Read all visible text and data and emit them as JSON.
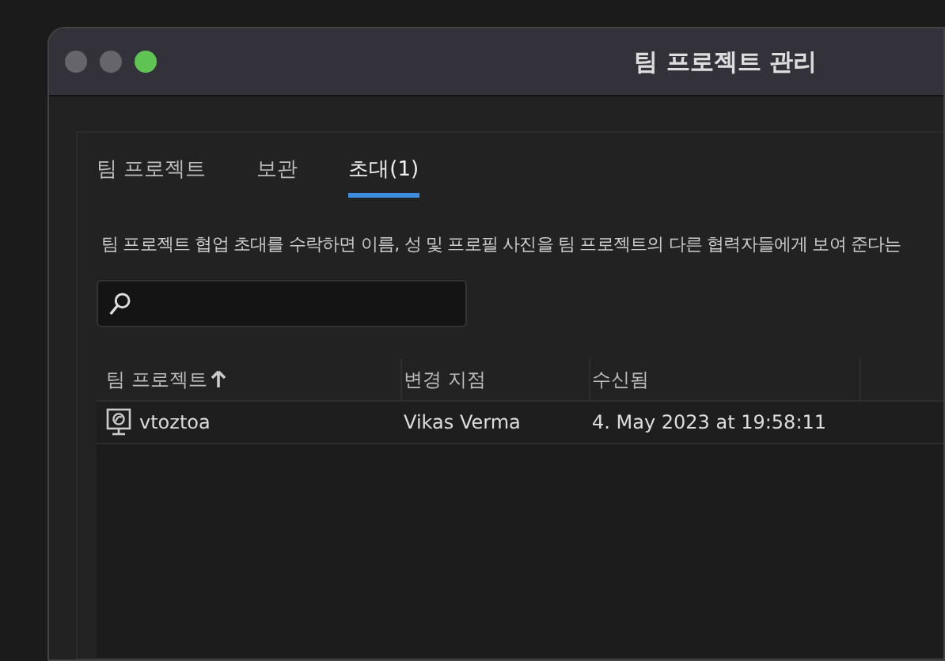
{
  "window": {
    "title": "팀 프로젝트 관리"
  },
  "traffic_lights": [
    {
      "kind": "close"
    },
    {
      "kind": "minimize"
    },
    {
      "kind": "zoom"
    }
  ],
  "tabs": [
    {
      "label": "팀 프로젝트",
      "selected": false
    },
    {
      "label": "보관",
      "selected": false
    },
    {
      "label": "초대(1)",
      "selected": true
    }
  ],
  "description": "팀 프로젝트 협업 초대를 수락하면 이름, 성 및 프로필 사진을 팀 프로젝트의 다른 협력자들에게 보여 준다는",
  "table": {
    "columns": [
      {
        "label": "팀 프로젝트",
        "sorted": true
      },
      {
        "label": "변경 지점",
        "sorted": false
      },
      {
        "label": "수신됨",
        "sorted": false
      }
    ],
    "rows": [
      {
        "cells": [
          "vtoztoa",
          "Vikas Verma",
          "4. May 2023 at 19:58:11"
        ],
        "selected": false
      }
    ]
  }
}
